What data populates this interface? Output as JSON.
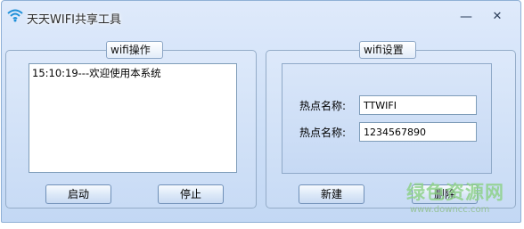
{
  "window": {
    "title": "天天WIFI共享工具",
    "minimize_glyph": "—",
    "close_glyph": "✕",
    "icon": "wifi-icon"
  },
  "left_panel": {
    "legend": "wifi操作",
    "log_text": "15:10:19---欢迎使用本系统",
    "start_label": "启动",
    "stop_label": "停止"
  },
  "right_panel": {
    "legend": "wifi设置",
    "field1_label": "热点名称:",
    "field1_value": "TTWIFI",
    "field2_label": "热点名称:",
    "field2_value": "1234567890",
    "new_label": "新建",
    "delete_label": "删除"
  },
  "watermark": {
    "main": "绿色资源网",
    "url": "www.downcc.com"
  }
}
